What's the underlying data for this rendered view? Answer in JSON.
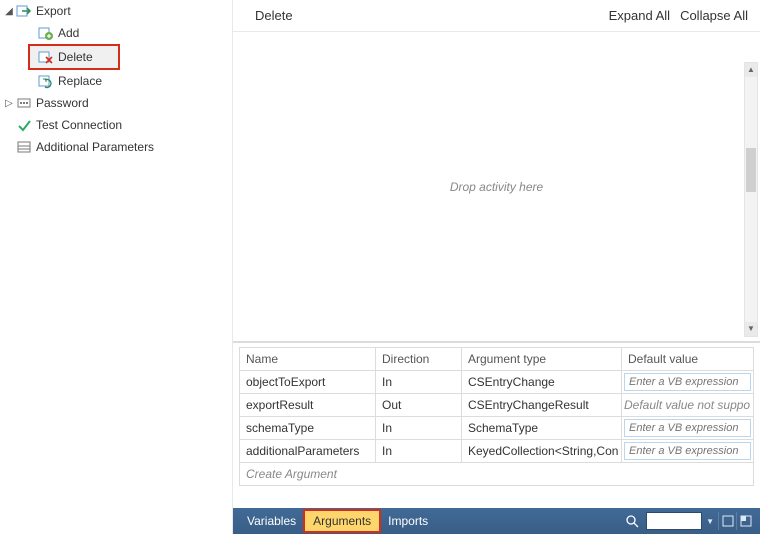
{
  "tree": {
    "export": {
      "label": "Export",
      "expanded": true
    },
    "add": {
      "label": "Add"
    },
    "delete": {
      "label": "Delete",
      "selected": true,
      "highlighted": true
    },
    "replace": {
      "label": "Replace"
    },
    "password": {
      "label": "Password",
      "expanded": false
    },
    "testConnection": {
      "label": "Test Connection"
    },
    "additionalParameters": {
      "label": "Additional Parameters"
    }
  },
  "toolbar": {
    "title": "Delete",
    "expandAll": "Expand All",
    "collapseAll": "Collapse All"
  },
  "designer": {
    "hint": "Drop activity here"
  },
  "argsTable": {
    "headers": {
      "name": "Name",
      "direction": "Direction",
      "type": "Argument type",
      "default": "Default value"
    },
    "rows": [
      {
        "name": "objectToExport",
        "direction": "In",
        "type": "CSEntryChange",
        "default": "Enter a VB expression",
        "editable": true
      },
      {
        "name": "exportResult",
        "direction": "Out",
        "type": "CSEntryChangeResult",
        "default": "Default value not suppo",
        "editable": false
      },
      {
        "name": "schemaType",
        "direction": "In",
        "type": "SchemaType",
        "default": "Enter a VB expression",
        "editable": true
      },
      {
        "name": "additionalParameters",
        "direction": "In",
        "type": "KeyedCollection<String,Con",
        "default": "Enter a VB expression",
        "editable": true
      }
    ],
    "createLabel": "Create Argument"
  },
  "bottomBar": {
    "variables": "Variables",
    "arguments": "Arguments",
    "imports": "Imports"
  }
}
